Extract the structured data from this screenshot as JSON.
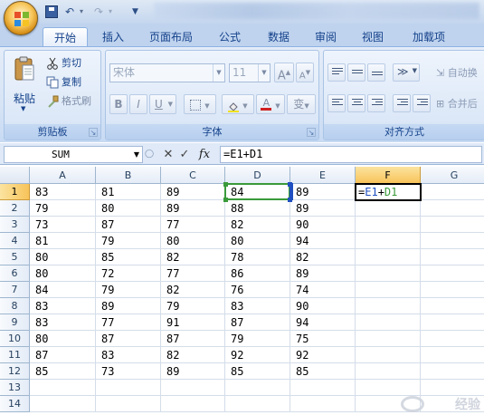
{
  "quick_access": {
    "undo_icon": "undo-icon",
    "redo_icon": "redo-icon",
    "save_icon": "save-icon",
    "undo_glyph": "↶",
    "redo_glyph": "↷",
    "dd_glyph": "▾",
    "customize_glyph": "▼"
  },
  "tabs": [
    "开始",
    "插入",
    "页面布局",
    "公式",
    "数据",
    "审阅",
    "视图",
    "加载项"
  ],
  "active_tab": "开始",
  "clipboard": {
    "label": "剪贴板",
    "paste": "粘贴",
    "cut": "剪切",
    "copy": "复制",
    "format_painter": "格式刷"
  },
  "font": {
    "label": "字体",
    "font_name": "宋体",
    "font_size": "11",
    "grow": "A",
    "shrink": "A",
    "bold": "B",
    "italic": "I",
    "underline": "U",
    "phonetic": "变"
  },
  "alignment": {
    "label": "对齐方式",
    "wrap_text": "自动换",
    "merge": "合并后"
  },
  "formula_bar": {
    "name_box": "SUM",
    "cancel_glyph": "✕",
    "enter_glyph": "✓",
    "fx_glyph": "fx",
    "formula": "=E1+D1"
  },
  "sheet": {
    "columns": [
      "A",
      "B",
      "C",
      "D",
      "E",
      "F",
      "G"
    ],
    "rows": [
      "1",
      "2",
      "3",
      "4",
      "5",
      "6",
      "7",
      "8",
      "9",
      "10",
      "11",
      "12",
      "13",
      "14"
    ],
    "selected_column": "F",
    "selected_row": "1",
    "cells": [
      [
        "83",
        "81",
        "89",
        "84",
        "89",
        "=E1+D1",
        ""
      ],
      [
        "79",
        "80",
        "89",
        "88",
        "89",
        "",
        ""
      ],
      [
        "73",
        "87",
        "77",
        "82",
        "90",
        "",
        ""
      ],
      [
        "81",
        "79",
        "80",
        "80",
        "94",
        "",
        ""
      ],
      [
        "80",
        "85",
        "82",
        "78",
        "82",
        "",
        ""
      ],
      [
        "80",
        "72",
        "77",
        "86",
        "89",
        "",
        ""
      ],
      [
        "84",
        "79",
        "82",
        "76",
        "74",
        "",
        ""
      ],
      [
        "83",
        "89",
        "79",
        "83",
        "90",
        "",
        ""
      ],
      [
        "83",
        "77",
        "91",
        "87",
        "94",
        "",
        ""
      ],
      [
        "80",
        "87",
        "87",
        "79",
        "75",
        "",
        ""
      ],
      [
        "87",
        "83",
        "82",
        "92",
        "92",
        "",
        ""
      ],
      [
        "85",
        "73",
        "89",
        "85",
        "85",
        "",
        ""
      ],
      [
        "",
        "",
        "",
        "",
        "",
        "",
        ""
      ],
      [
        "",
        "",
        "",
        "",
        "",
        "",
        ""
      ]
    ],
    "ref_colors": {
      "e1": "#2050c0",
      "d1": "#3a9a3a"
    }
  },
  "watermark": "经验"
}
